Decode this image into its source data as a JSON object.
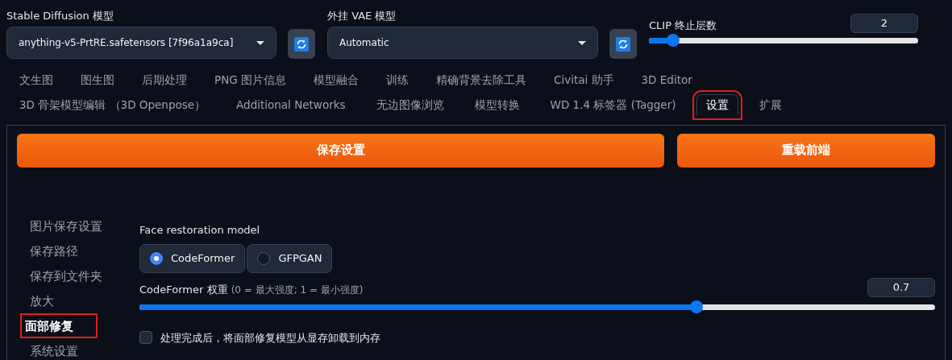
{
  "top": {
    "model": {
      "label": "Stable Diffusion 模型",
      "value": "anything-v5-PrtRE.safetensors [7f96a1a9ca]"
    },
    "vae": {
      "label": "外挂 VAE 模型",
      "value": "Automatic"
    },
    "clip": {
      "label": "CLIP 终止层数",
      "value": "2",
      "level": 0.09
    }
  },
  "tabs": [
    [
      {
        "label": "文生图",
        "selected": false,
        "highlighted": false
      },
      {
        "label": "图生图",
        "selected": false,
        "highlighted": false
      },
      {
        "label": "后期处理",
        "selected": false,
        "highlighted": false
      },
      {
        "label": "PNG 图片信息",
        "selected": false,
        "highlighted": false
      },
      {
        "label": "模型融合",
        "selected": false,
        "highlighted": false
      },
      {
        "label": "训练",
        "selected": false,
        "highlighted": false
      },
      {
        "label": "精确背景去除工具",
        "selected": false,
        "highlighted": false
      },
      {
        "label": "Civitai 助手",
        "selected": false,
        "highlighted": false
      },
      {
        "label": "3D Editor",
        "selected": false,
        "highlighted": false
      }
    ],
    [
      {
        "label": "3D 骨架模型编辑 （3D Openpose）",
        "selected": false,
        "highlighted": false
      },
      {
        "label": "Additional Networks",
        "selected": false,
        "highlighted": false
      },
      {
        "label": "无边图像浏览",
        "selected": false,
        "highlighted": false
      },
      {
        "label": "模型转换",
        "selected": false,
        "highlighted": false
      },
      {
        "label": "WD 1.4 标签器 (Tagger)",
        "selected": false,
        "highlighted": false
      },
      {
        "label": "设置",
        "selected": true,
        "highlighted": true
      },
      {
        "label": "扩展",
        "selected": false,
        "highlighted": false
      }
    ]
  ],
  "actions": [
    {
      "label": "保存设置"
    },
    {
      "label": "重载前端"
    }
  ],
  "sidebar": {
    "items": [
      {
        "label": "图片保存设置",
        "selected": false,
        "highlighted": false
      },
      {
        "label": "保存路径",
        "selected": false,
        "highlighted": false
      },
      {
        "label": "保存到文件夹",
        "selected": false,
        "highlighted": false
      },
      {
        "label": "放大",
        "selected": false,
        "highlighted": false
      },
      {
        "label": "面部修复",
        "selected": true,
        "highlighted": true
      },
      {
        "label": "系统设置",
        "selected": false,
        "highlighted": false
      }
    ]
  },
  "settings": {
    "face_model": {
      "label": "Face restoration model",
      "options": [
        {
          "label": "CodeFormer",
          "selected": true
        },
        {
          "label": "GFPGAN",
          "selected": false
        }
      ]
    },
    "weight": {
      "label": "CodeFormer 权重 ",
      "hint": "(0 = 最大强度; 1 = 最小强度)",
      "value": "0.7",
      "level": 0.7
    },
    "unload": {
      "label": "处理完成后，将面部修复模型从显存卸载到内存",
      "checked": false
    }
  }
}
